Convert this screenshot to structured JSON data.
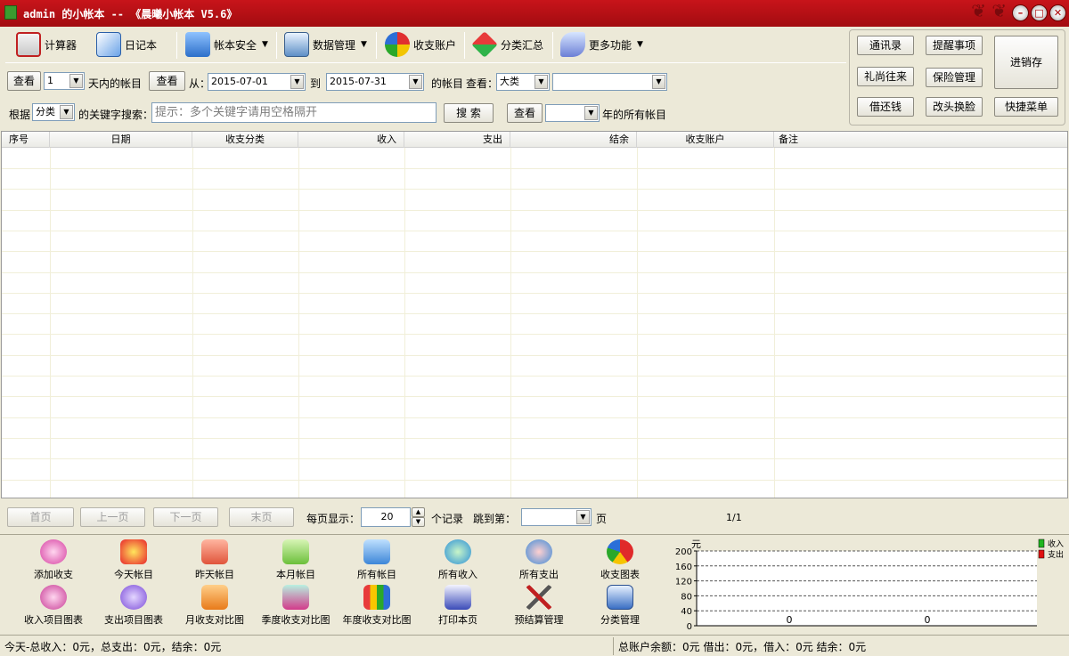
{
  "window": {
    "title": "admin 的小帐本 -- 《晨曦小帐本 V5.6》"
  },
  "toolbar": {
    "calculator": "计算器",
    "diary": "日记本",
    "account_security": "帐本安全",
    "data_management": "数据管理",
    "accounts": "收支账户",
    "category_summary": "分类汇总",
    "more": "更多功能"
  },
  "right_panel": {
    "contacts": "通讯录",
    "reminders": "提醒事项",
    "inventory": "进销存",
    "gifts": "礼尚往来",
    "insurance": "保险管理",
    "loans": "借还钱",
    "skin": "改头换脸",
    "quick_menu": "快捷菜单"
  },
  "filters": {
    "view_button": "查看",
    "days_value": "1",
    "days_label": "天内的帐目",
    "from_label": "从：",
    "from_date": "2015-07-01",
    "to_label": "到",
    "to_date": "2015-07-31",
    "of_accounts_label": "的帐目",
    "view_label": "查看：",
    "category_level": "大类",
    "category_value": "",
    "by_label": "根据",
    "by_value": "分类",
    "keyword_label": "的关键字搜索：",
    "keyword_placeholder": "提示：多个关键字请用空格隔开",
    "search_button": "搜 索",
    "year_value": "",
    "year_label": "年的所有帐目"
  },
  "table": {
    "columns": [
      "序号",
      "日期",
      "收支分类",
      "收入",
      "支出",
      "结余",
      "收支账户",
      "备注"
    ],
    "rows": []
  },
  "pager": {
    "first": "首页",
    "prev": "上一页",
    "next": "下一页",
    "last": "末页",
    "per_page_label": "每页显示：",
    "per_page_value": "20",
    "records_label": "个记录",
    "jump_label": "跳到第：",
    "jump_value": "",
    "page_unit": "页",
    "page_indicator": "1/1"
  },
  "bottom_icons": {
    "add": "添加收支",
    "today": "今天帐目",
    "yesterday": "昨天帐目",
    "this_month": "本月帐目",
    "all": "所有帐目",
    "all_income": "所有收入",
    "all_expense": "所有支出",
    "chart": "收支图表",
    "income_item_chart": "收入项目图表",
    "expense_item_chart": "支出项目图表",
    "monthly_compare": "月收支对比图",
    "quarter_compare": "季度收支对比图",
    "year_compare": "年度收支对比图",
    "print_page": "打印本页",
    "budget": "预结算管理",
    "category_mgmt": "分类管理"
  },
  "mini_chart": {
    "unit": "元",
    "legend_income": "收入",
    "legend_expense": "支出",
    "income_color": "#1fb51f",
    "expense_color": "#e01010"
  },
  "chart_data": {
    "type": "bar",
    "title": "",
    "ylabel": "元",
    "ylim": [
      0,
      200
    ],
    "yticks": [
      0,
      40,
      80,
      120,
      160,
      200
    ],
    "series": [
      {
        "name": "收入",
        "values": [
          0
        ]
      },
      {
        "name": "支出",
        "values": [
          0
        ]
      }
    ],
    "grid": true,
    "legend": "top-right"
  },
  "status": {
    "today": "今天-总收入：0元，总支出：0元，结余：0元",
    "totals": "总账户余额：0元 借出：0元，借入：0元 结余：0元"
  }
}
